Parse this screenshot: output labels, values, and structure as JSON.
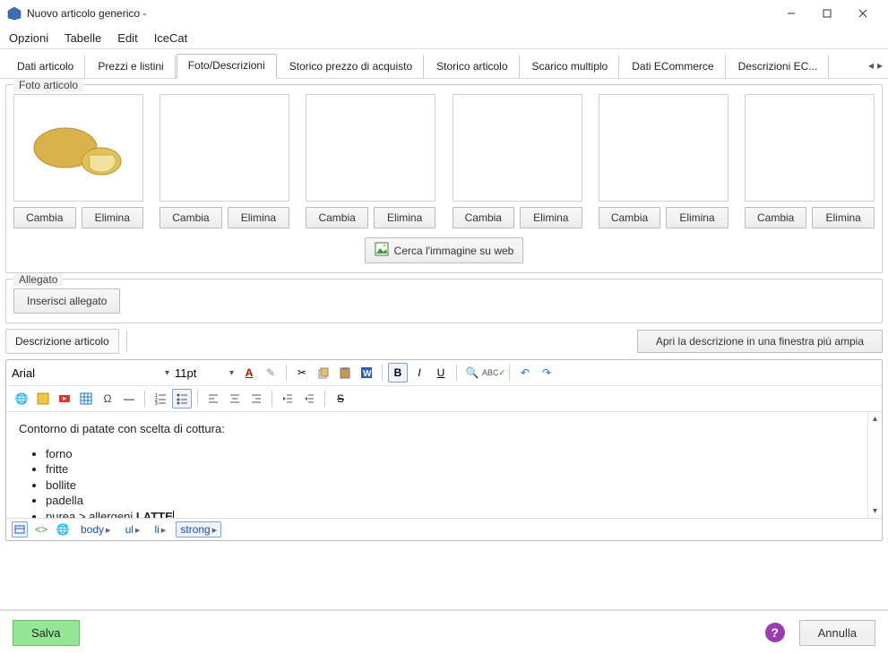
{
  "window": {
    "title": "Nuovo articolo generico -"
  },
  "menu": {
    "opzioni": "Opzioni",
    "tabelle": "Tabelle",
    "edit": "Edit",
    "icecat": "IceCat"
  },
  "tabs": {
    "dati_articolo": "Dati articolo",
    "prezzi_listini": "Prezzi e listini",
    "foto_descrizioni": "Foto/Descrizioni",
    "storico_prezzo_acquisto": "Storico prezzo di acquisto",
    "storico_articolo": "Storico articolo",
    "scarico_multiplo": "Scarico multiplo",
    "dati_ecommerce": "Dati ECommerce",
    "descrizioni_ec": "Descrizioni  EC..."
  },
  "groups": {
    "foto_articolo": "Foto articolo",
    "allegato": "Allegato",
    "descrizione_articolo": "Descrizione articolo"
  },
  "buttons": {
    "cambia": "Cambia",
    "elimina": "Elimina",
    "cerca_immagine_web": "Cerca l'immagine su web",
    "inserisci_allegato": "Inserisci allegato",
    "apri_descrizione_ampia": "Apri la descrizione in una finestra più ampia",
    "salva": "Salva",
    "annulla": "Annulla",
    "help": "?"
  },
  "editor": {
    "font_name": "Arial",
    "font_size": "11pt",
    "body_intro": "Contorno di patate con scelta di cottura:",
    "list": {
      "i0": "forno",
      "i1": "fritte",
      "i2": "bollite",
      "i3": "padella",
      "i4_prefix": "purea > allergeni ",
      "i4_strong": "LATTE"
    },
    "path": {
      "body": "body",
      "ul": "ul",
      "li": "li",
      "strong": "strong"
    }
  }
}
